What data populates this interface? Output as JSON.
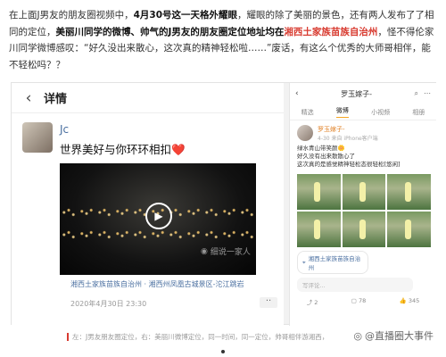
{
  "article": {
    "p1": "在上面J男友的朋友圈视频中，",
    "p2": "4月30号这一天格外耀眼",
    "p3": "，耀眼的除了美丽的景色，还有两人发布了了相同的定位，",
    "p4": "美丽川同学的微博、帅气的J男友的朋友圈定位地址均在",
    "p5": "湘西土家族苗族自治州",
    "p6": "，怪不得伦家川同学微博感叹：“好久没出来散心，这次真的精神轻松啦……”废话，有这么个优秀的大师哥相伴，能不轻松吗？？"
  },
  "left": {
    "title": "详情",
    "back_icon": "chevron-left",
    "username": "Jc",
    "text": "世界美好与你环环相扣",
    "heart": "❤️",
    "watermark": "细说一家人",
    "location": "湘西土家族苗族自治州 · 湘西州凤凰古城景区-沱江跳岩",
    "date": "2020年4月30日 23:30",
    "more": "··"
  },
  "right": {
    "name": "罗玉嫁子-",
    "tabs": [
      "精选",
      "微博",
      "小视频",
      "相册"
    ],
    "active_tab": "微博",
    "uname": "罗玉嫁子-",
    "sub": "4-30 来自 iPhone客户端",
    "text1": "绿水青山带笑颜🌼",
    "text2": "好久没有出来散散心了",
    "text3": "这次真的是感觉精神轻松态很轻松[悠闲]",
    "location": "湘西土家族苗族自治州",
    "comment": "写评论...",
    "actions": {
      "share": "2",
      "comment": "78",
      "like": "345"
    }
  },
  "caption": "左：J男友朋友圈定位，右：美丽川微博定位，同一时间，同一定位，帅哥相伴游湘西，",
  "brand": "@直播圈大事件"
}
